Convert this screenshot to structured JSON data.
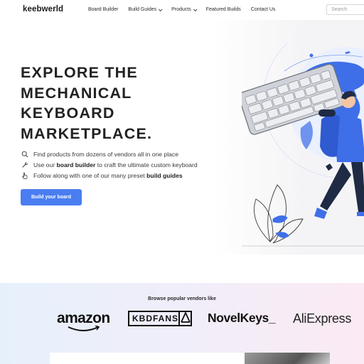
{
  "nav": {
    "logo": "keebwerld",
    "links": [
      {
        "label": "Board Builder"
      },
      {
        "label": "Build Guides"
      },
      {
        "label": "Products"
      },
      {
        "label": "Featured Builds"
      },
      {
        "label": "Contact Us"
      }
    ],
    "search_placeholder": "Search"
  },
  "hero": {
    "headline": [
      "EXPLORE THE",
      "MECHANICAL",
      "KEYBOARD",
      "MARKETPLACE."
    ],
    "features": [
      {
        "icon": "search-icon",
        "pre": "Find products from dozens of vendors all in one place",
        "bold": "",
        "post": ""
      },
      {
        "icon": "wrench-icon",
        "pre": "Use our ",
        "bold": "board builder",
        "post": " to craft the ultimate custom keyboard"
      },
      {
        "icon": "hand-pointer-icon",
        "pre": "Follow along with one of our many preset ",
        "bold": "build guides",
        "post": ""
      }
    ],
    "cta_label": "Build your board"
  },
  "vendors": {
    "title": "Browse popular vendors like",
    "names": [
      "amazon",
      "KBDFANS",
      "NovelKeys_",
      "AliExpress"
    ]
  },
  "colors": {
    "accent": "#4a7df0",
    "illustration_blue": "#3f6fe8"
  }
}
